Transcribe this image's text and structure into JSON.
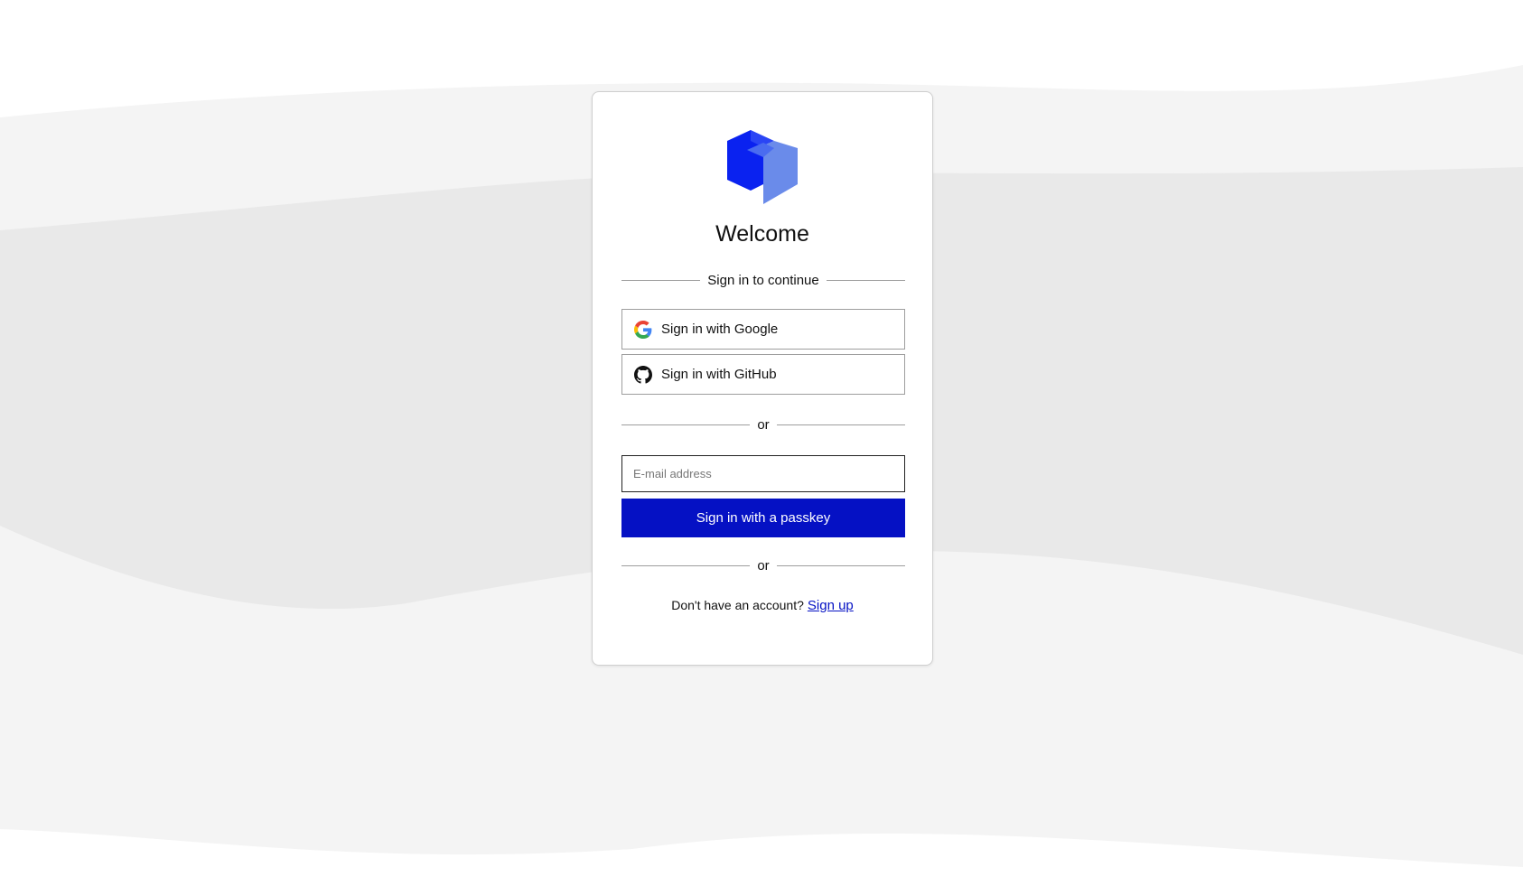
{
  "brand": {
    "logo_icon": "cube-logo-icon",
    "primary_color": "#0511c4",
    "logo_dark": "#0a22f0",
    "logo_light": "#6a8bea"
  },
  "title": "Welcome",
  "subtitle": "Sign in to continue",
  "sso": {
    "google_label": "Sign in with Google",
    "google_icon": "google-icon",
    "github_label": "Sign in with GitHub",
    "github_icon": "github-icon"
  },
  "or_label_1": "or",
  "email": {
    "placeholder": "E-mail address",
    "value": ""
  },
  "passkey_label": "Sign in with a passkey",
  "or_label_2": "or",
  "signup": {
    "prompt": "Don't have an account?",
    "link_label": "Sign up"
  }
}
